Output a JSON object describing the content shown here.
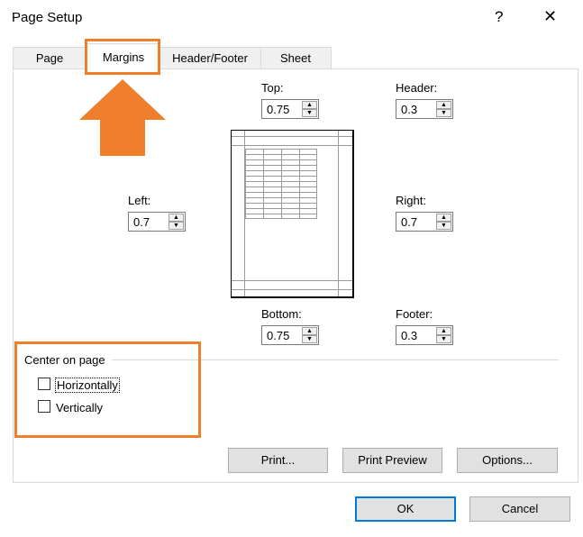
{
  "window": {
    "title": "Page Setup",
    "help": "?",
    "close": "✕"
  },
  "tabs": [
    {
      "label": "Page"
    },
    {
      "label": "Margins"
    },
    {
      "label": "Header/Footer"
    },
    {
      "label": "Sheet"
    }
  ],
  "margins": {
    "top": {
      "label": "Top:",
      "value": "0.75"
    },
    "header": {
      "label": "Header:",
      "value": "0.3"
    },
    "left": {
      "label": "Left:",
      "value": "0.7"
    },
    "right": {
      "label": "Right:",
      "value": "0.7"
    },
    "bottom": {
      "label": "Bottom:",
      "value": "0.75"
    },
    "footer": {
      "label": "Footer:",
      "value": "0.3"
    }
  },
  "center_on_page": {
    "title": "Center on page",
    "horizontally": {
      "label": "Horizontally",
      "checked": false
    },
    "vertically": {
      "label": "Vertically",
      "checked": false
    }
  },
  "buttons": {
    "print": "Print...",
    "print_preview": "Print Preview",
    "options": "Options...",
    "ok": "OK",
    "cancel": "Cancel"
  },
  "annotation_color": "#f07f2d",
  "focus_color": "#0078d7"
}
